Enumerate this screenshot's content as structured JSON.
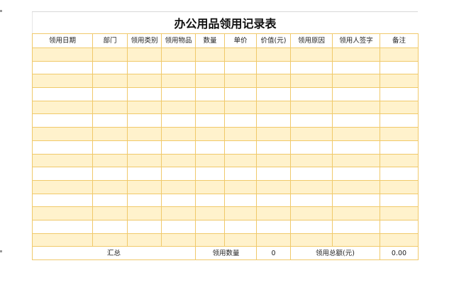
{
  "sheet": {
    "title": "办公用品领用记录表",
    "headers": [
      "领用日期",
      "部门",
      "领用类别",
      "领用物品",
      "数量",
      "单价",
      "价值(元)",
      "领用原因",
      "领用人签字",
      "备注"
    ],
    "empty_row_count": 15,
    "summary": {
      "label": "汇总",
      "qty_label": "领用数量",
      "qty_value": "0",
      "amount_label": "领用总额(元)",
      "amount_value": "0.00"
    },
    "band_color": "#fff2cc",
    "border_color": "#f0c96a"
  }
}
